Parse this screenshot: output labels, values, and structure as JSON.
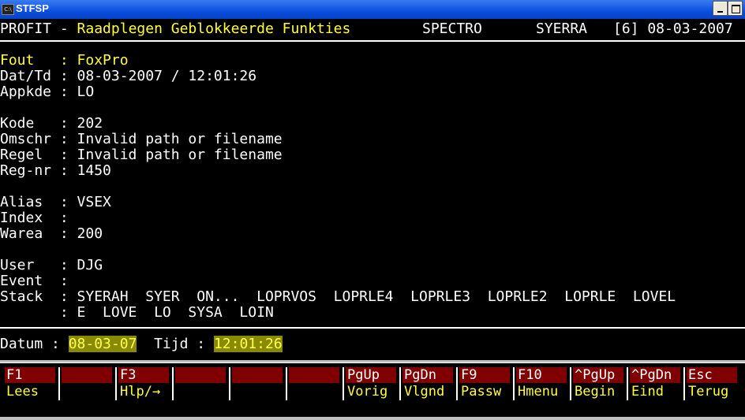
{
  "window": {
    "title": "STFSP",
    "icon_text": "C:\\"
  },
  "header": {
    "left": "PROFIT - ",
    "title": "Raadplegen Geblokkeerde Funkties",
    "company": "SPECTRO",
    "user": "SYERRA",
    "info": "[6] 08-03-2007"
  },
  "fields": {
    "fout": {
      "label": "Fout   : ",
      "value": "FoxPro"
    },
    "dattd": "Dat/Td : 08-03-2007 / 12:01:26",
    "appkde": "Appkde : LO",
    "kode": "Kode   : 202",
    "omschr": "Omschr : Invalid path or filename",
    "regel": "Regel  : Invalid path or filename",
    "regnr": "Reg-nr : 1450",
    "alias": "Alias  : VSEX",
    "index": "Index  :",
    "warea": "Warea  : 200",
    "user": "User   : DJG",
    "event": "Event  :",
    "stack1": "Stack  : SYERAH  SYER  ON...  LOPRVOS  LOPRLE4  LOPRLE3  LOPRLE2  LOPRLE  LOVEL",
    "stack2": "       : E  LOVE  LO  SYSA  LOIN"
  },
  "status": {
    "datum_label": "Datum : ",
    "datum_value": "08-03-07",
    "tijd_label": "  Tijd : ",
    "tijd_value": "12:01:26"
  },
  "fkeys": [
    {
      "key": "F1",
      "label": "Lees"
    },
    {
      "key": "",
      "label": ""
    },
    {
      "key": "F3",
      "label": "Hlp/→"
    },
    {
      "key": "",
      "label": ""
    },
    {
      "key": "",
      "label": ""
    },
    {
      "key": "",
      "label": ""
    },
    {
      "key": "PgUp",
      "label": "Vorig"
    },
    {
      "key": "PgDn",
      "label": "Vlgnd"
    },
    {
      "key": "F9",
      "label": "Passw"
    },
    {
      "key": "F10",
      "label": "Hmenu"
    },
    {
      "key": "^PgUp",
      "label": "Begin"
    },
    {
      "key": "^PgDn",
      "label": "Eind"
    },
    {
      "key": "Esc",
      "label": "Terug"
    }
  ]
}
